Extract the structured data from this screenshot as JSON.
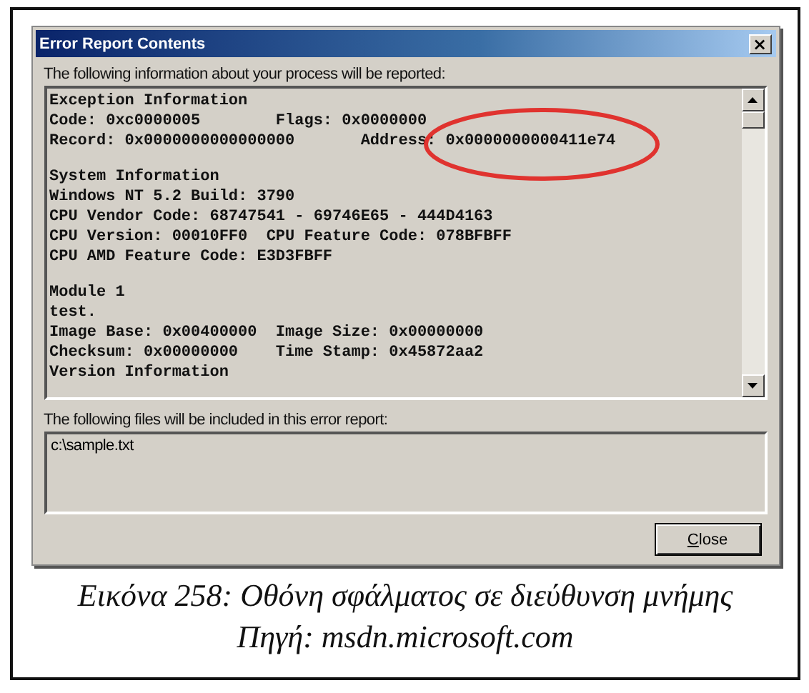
{
  "window": {
    "title": "Error Report Contents",
    "close": "×"
  },
  "report": {
    "label": "The following information about your process will be reported:",
    "sections": [
      {
        "lines": [
          "Exception Information",
          "Code: 0xc0000005        Flags: 0x0000000",
          "Record: 0x0000000000000000       Address: 0x0000000000411e74"
        ]
      },
      {
        "lines": [
          "System Information",
          "Windows NT 5.2 Build: 3790",
          "CPU Vendor Code: 68747541 - 69746E65 - 444D4163",
          "CPU Version: 00010FF0  CPU Feature Code: 078BFBFF",
          "CPU AMD Feature Code: E3D3FBFF"
        ]
      },
      {
        "lines": [
          "Module 1",
          "test.",
          "Image Base: 0x00400000  Image Size: 0x00000000",
          "Checksum: 0x00000000    Time Stamp: 0x45872aa2",
          "Version Information"
        ]
      }
    ],
    "highlight": {
      "color": "#e0332f"
    }
  },
  "files": {
    "label": "The following files will be included in this error report:",
    "items": [
      "c:\\sample.txt"
    ]
  },
  "buttons": [
    {
      "label": "Close"
    }
  ],
  "caption": {
    "title": "Εικόνα 258: Οθόνη σφάλματος σε διεύθυνση μνήμης",
    "source": "Πηγή: msdn.microsoft.com"
  }
}
